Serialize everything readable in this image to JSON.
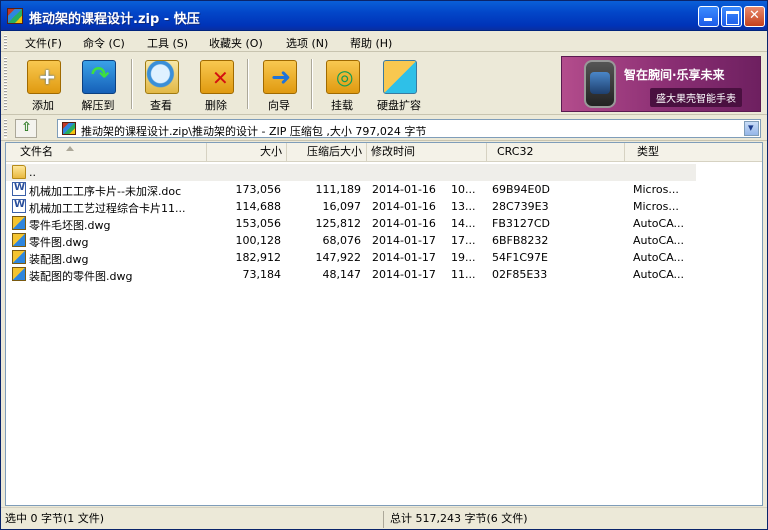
{
  "window": {
    "title": "推动架的课程设计.zip - 快压"
  },
  "menu": [
    "文件(F)",
    "命令 (C)",
    "工具 (S)",
    "收藏夹 (O)",
    "选项 (N)",
    "帮助 (H)"
  ],
  "toolbar": {
    "add": "添加",
    "extract": "解压到",
    "view": "查看",
    "delete": "删除",
    "wizard": "向导",
    "mount": "挂载",
    "disk": "硬盘扩容"
  },
  "ad": {
    "title": "智在腕间·乐享未来",
    "subtitle": "盛大果壳智能手表"
  },
  "address": {
    "text": "推动架的课程设计.zip\\推动架的设计 - ZIP 压缩包 ,大小 797,024 字节"
  },
  "columns": {
    "name": "文件名",
    "size": "大小",
    "packed": "压缩后大小",
    "modified": "修改时间",
    "crc": "CRC32",
    "type": "类型"
  },
  "parent_row": {
    "name": ".."
  },
  "files": [
    {
      "name": "机械加工工序卡片--未加深.doc",
      "size": "173,056",
      "packed": "111,189",
      "date": "2014-01-16",
      "time": "10...",
      "crc": "69B94E0D",
      "type": "Micros...",
      "icon": "word-doc-icon"
    },
    {
      "name": "机械加工工艺过程综合卡片11...",
      "size": "114,688",
      "packed": "16,097",
      "date": "2014-01-16",
      "time": "13...",
      "crc": "28C739E3",
      "type": "Micros...",
      "icon": "word-doc-icon"
    },
    {
      "name": "零件毛坯图.dwg",
      "size": "153,056",
      "packed": "125,812",
      "date": "2014-01-16",
      "time": "14...",
      "crc": "FB3127CD",
      "type": "AutoCA...",
      "icon": "dwg-file-icon"
    },
    {
      "name": "零件图.dwg",
      "size": "100,128",
      "packed": "68,076",
      "date": "2014-01-17",
      "time": "17...",
      "crc": "6BFB8232",
      "type": "AutoCA...",
      "icon": "dwg-file-icon"
    },
    {
      "name": "装配图.dwg",
      "size": "182,912",
      "packed": "147,922",
      "date": "2014-01-17",
      "time": "19...",
      "crc": "54F1C97E",
      "type": "AutoCA...",
      "icon": "dwg-file-icon"
    },
    {
      "name": "装配图的零件图.dwg",
      "size": "73,184",
      "packed": "48,147",
      "date": "2014-01-17",
      "time": "11...",
      "crc": "02F85E33",
      "type": "AutoCA...",
      "icon": "dwg-file-icon"
    }
  ],
  "status": {
    "selected": "选中  0 字节(1 文件)",
    "total": "总计  517,243 字节(6 文件)"
  }
}
